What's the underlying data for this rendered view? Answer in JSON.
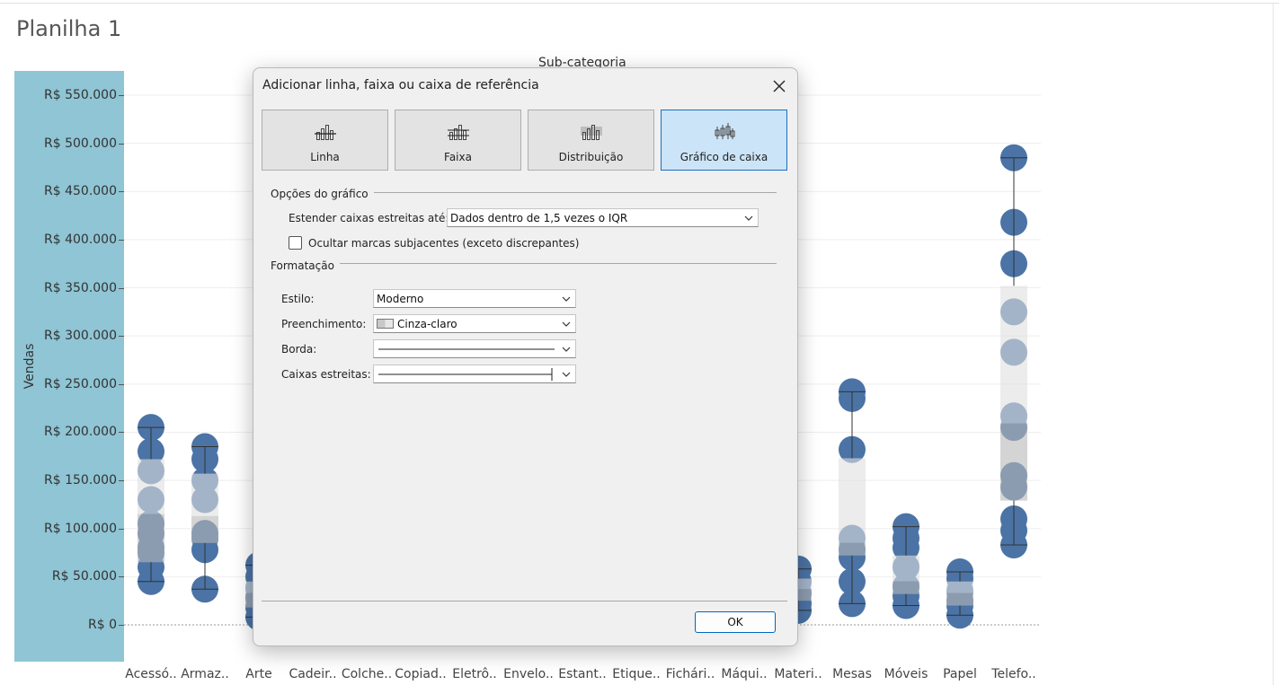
{
  "sheet": {
    "title": "Planilha 1"
  },
  "chart_data": {
    "type": "box",
    "column_header": "Sub-categoria",
    "ylabel": "Vendas",
    "ylim": [
      0,
      550000
    ],
    "y_ticks": [
      "R$ 550.000",
      "R$ 500.000",
      "R$ 450.000",
      "R$ 400.000",
      "R$ 350.000",
      "R$ 300.000",
      "R$ 250.000",
      "R$ 200.000",
      "R$ 150.000",
      "R$ 100.000",
      "R$ 50.000",
      "R$ 0"
    ],
    "y_tick_values": [
      550000,
      500000,
      450000,
      400000,
      350000,
      300000,
      250000,
      200000,
      150000,
      100000,
      50000,
      0
    ],
    "categories": [
      "Acessó..",
      "Armaz..",
      "Arte",
      "Cadeir..",
      "Colche..",
      "Copiad..",
      "Eletrô..",
      "Envelo..",
      "Estant..",
      "Etique..",
      "Fichári..",
      "Máqui..",
      "Materi..",
      "Mesas",
      "Móveis",
      "Papel",
      "Telefo.."
    ],
    "series": [
      {
        "category": "Acessó..",
        "whisker_low": 45000,
        "q1": 65000,
        "median": 115000,
        "q3": 172000,
        "whisker_high": 205000,
        "points": [
          205000,
          180000,
          160000,
          130000,
          105000,
          95000,
          80000,
          75000,
          60000,
          45000
        ]
      },
      {
        "category": "Armaz..",
        "whisker_low": 37000,
        "q1": 85000,
        "median": 113000,
        "q3": 157000,
        "whisker_high": 185000,
        "points": [
          185000,
          172000,
          150000,
          130000,
          95000,
          90000,
          78000,
          37000
        ]
      },
      {
        "category": "Arte",
        "whisker_low": 8000,
        "q1": 18000,
        "median": 33000,
        "q3": 45000,
        "whisker_high": 62000,
        "points": [
          62000,
          50000,
          38000,
          28000,
          18000,
          8000
        ]
      },
      {
        "category": "Materi..",
        "whisker_low": 15000,
        "q1": 25000,
        "median": 37000,
        "q3": 48000,
        "whisker_high": 58000,
        "points": [
          58000,
          45000,
          33000,
          22000,
          15000
        ]
      },
      {
        "category": "Mesas",
        "whisker_low": 22000,
        "q1": 72000,
        "median": 85000,
        "q3": 173000,
        "whisker_high": 242000,
        "points": [
          242000,
          235000,
          182000,
          90000,
          78000,
          70000,
          45000,
          22000
        ]
      },
      {
        "category": "Móveis",
        "whisker_low": 20000,
        "q1": 32000,
        "median": 45000,
        "q3": 72000,
        "whisker_high": 102000,
        "points": [
          102000,
          90000,
          80000,
          60000,
          40000,
          30000,
          20000
        ]
      },
      {
        "category": "Papel",
        "whisker_low": 10000,
        "q1": 20000,
        "median": 33000,
        "q3": 45000,
        "whisker_high": 55000,
        "points": [
          55000,
          48000,
          35000,
          25000,
          20000,
          10000
        ]
      },
      {
        "category": "Telefo..",
        "whisker_low": 83000,
        "q1": 129000,
        "median": 209000,
        "q3": 352000,
        "whisker_high": 485000,
        "points": [
          485000,
          418000,
          375000,
          325000,
          283000,
          217000,
          205000,
          155000,
          143000,
          110000,
          98000,
          83000
        ]
      }
    ],
    "grid": true,
    "colors": {
      "point": "#4b73a5",
      "box_upper": "#e0e0e0",
      "box_lower": "#b8b8b8",
      "axis_panel": "#8fc5d4"
    }
  },
  "dialog": {
    "title": "Adicionar linha, faixa ou caixa de referência",
    "close_icon": "close-icon",
    "types": [
      {
        "label": "Linha",
        "icon": "line-chart-icon",
        "selected": false
      },
      {
        "label": "Faixa",
        "icon": "band-chart-icon",
        "selected": false
      },
      {
        "label": "Distribuição",
        "icon": "distribution-chart-icon",
        "selected": false
      },
      {
        "label": "Gráfico de caixa",
        "icon": "box-plot-icon",
        "selected": true
      }
    ],
    "options_section": "Opções do gráfico",
    "extend_label": "Estender caixas estreitas até:",
    "extend_value": "Dados dentro de 1,5 vezes o IQR",
    "hide_marks_label": "Ocultar marcas subjacentes (exceto discrepantes)",
    "hide_marks_checked": false,
    "format_section": "Formatação",
    "style_label": "Estilo:",
    "style_value": "Moderno",
    "fill_label": "Preenchimento:",
    "fill_value": "Cinza-claro",
    "border_label": "Borda:",
    "whiskers_label": "Caixas estreitas:",
    "ok_label": "OK"
  }
}
